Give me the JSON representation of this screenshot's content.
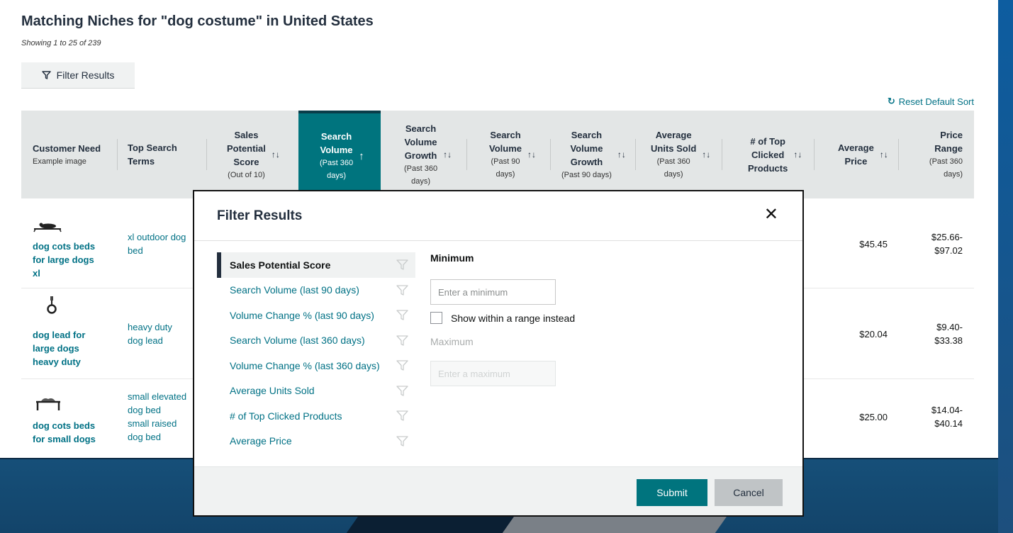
{
  "page": {
    "title": "Matching Niches for \"dog costume\" in United States",
    "showing": "Showing 1 to 25 of 239",
    "filter_button": "Filter Results",
    "reset_sort": "Reset Default Sort"
  },
  "table": {
    "columns": [
      {
        "label_lines": [
          "Customer Need"
        ],
        "sub_lines": [
          "Example image"
        ]
      },
      {
        "label_lines": [
          "Top Search",
          "Terms"
        ],
        "sub_lines": []
      },
      {
        "label_lines": [
          "Sales",
          "Potential",
          "Score"
        ],
        "sub_lines": [
          "(Out of 10)"
        ]
      },
      {
        "label_lines": [
          "Search",
          "Volume"
        ],
        "sub_lines": [
          "(Past 360",
          "days)"
        ]
      },
      {
        "label_lines": [
          "Search",
          "Volume",
          "Growth"
        ],
        "sub_lines": [
          "(Past 360",
          "days)"
        ]
      },
      {
        "label_lines": [
          "Search",
          "Volume"
        ],
        "sub_lines": [
          "(Past 90",
          "days)"
        ]
      },
      {
        "label_lines": [
          "Search",
          "Volume",
          "Growth"
        ],
        "sub_lines": [
          "(Past 90 days)"
        ]
      },
      {
        "label_lines": [
          "Average",
          "Units Sold"
        ],
        "sub_lines": [
          "(Past 360",
          "days)"
        ]
      },
      {
        "label_lines": [
          "# of Top",
          "Clicked",
          "Products"
        ],
        "sub_lines": []
      },
      {
        "label_lines": [
          "Average",
          "Price"
        ],
        "sub_lines": []
      },
      {
        "label_lines": [
          "Price",
          "Range"
        ],
        "sub_lines": [
          "(Past 360",
          "days)"
        ]
      }
    ],
    "rows": [
      {
        "icon": "dog-cot-icon",
        "need_lines": [
          "dog cots beds",
          "for large dogs",
          "xl"
        ],
        "term_lines": [
          "xl outdoor dog",
          "bed"
        ],
        "avg_price": "$45.45",
        "price_range_lines": [
          "$25.66-",
          "$97.02"
        ]
      },
      {
        "icon": "dog-lead-icon",
        "need_lines": [
          "dog lead for",
          "large dogs",
          "heavy duty"
        ],
        "term_lines": [
          "heavy duty",
          "dog lead"
        ],
        "avg_price": "$20.04",
        "price_range_lines": [
          "$9.40-",
          "$33.38"
        ]
      },
      {
        "icon": "small-dog-bed-icon",
        "need_lines": [
          "dog cots beds",
          "for small dogs"
        ],
        "term_lines": [
          "small elevated",
          "dog bed",
          "small raised",
          "dog bed"
        ],
        "avg_price": "$25.00",
        "price_range_lines": [
          "$14.04-",
          "$40.14"
        ]
      }
    ]
  },
  "modal": {
    "title": "Filter Results",
    "filters": [
      "Sales Potential Score",
      "Search Volume (last 90 days)",
      "Volume Change % (last 90 days)",
      "Search Volume (last 360 days)",
      "Volume Change % (last 360 days)",
      "Average Units Sold",
      "# of Top Clicked Products",
      "Average Price"
    ],
    "active_filter_index": 0,
    "minimum_label": "Minimum",
    "minimum_placeholder": "Enter a minimum",
    "range_checkbox_label": "Show within a range instead",
    "maximum_label": "Maximum",
    "maximum_placeholder": "Enter a maximum",
    "submit": "Submit",
    "cancel": "Cancel"
  },
  "colors": {
    "accent": "#00747e",
    "link": "#007185",
    "header_bg": "#e3e6e6",
    "background": "#1b3d5c"
  }
}
